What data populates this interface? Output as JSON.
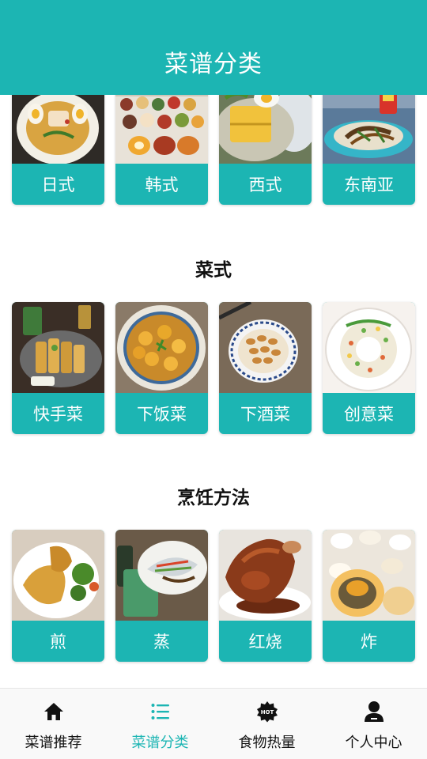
{
  "header": {
    "title": "菜谱分类"
  },
  "sections": [
    {
      "title": "",
      "items": [
        {
          "label": "日式",
          "image": "japanese-dish-photo"
        },
        {
          "label": "韩式",
          "image": "korean-dish-photo"
        },
        {
          "label": "西式",
          "image": "western-dish-photo"
        },
        {
          "label": "东南亚",
          "image": "southeast-asian-dish-photo"
        }
      ]
    },
    {
      "title": "菜式",
      "items": [
        {
          "label": "快手菜",
          "image": "quick-dish-photo"
        },
        {
          "label": "下饭菜",
          "image": "rice-dish-photo"
        },
        {
          "label": "下酒菜",
          "image": "wine-dish-photo"
        },
        {
          "label": "创意菜",
          "image": "creative-dish-photo"
        }
      ]
    },
    {
      "title": "烹饪方法",
      "items": [
        {
          "label": "煎",
          "image": "pan-fried-photo"
        },
        {
          "label": "蒸",
          "image": "steamed-photo"
        },
        {
          "label": "红烧",
          "image": "braised-photo"
        },
        {
          "label": "炸",
          "image": "deep-fried-photo"
        }
      ]
    }
  ],
  "tabbar": {
    "items": [
      {
        "label": "菜谱推荐",
        "icon": "home-icon",
        "active": false
      },
      {
        "label": "菜谱分类",
        "icon": "list-icon",
        "active": true
      },
      {
        "label": "食物热量",
        "icon": "hot-badge-icon",
        "active": false
      },
      {
        "label": "个人中心",
        "icon": "user-icon",
        "active": false
      }
    ]
  },
  "colors": {
    "accent": "#1cb5b3",
    "tab_active": "#1cb5b3",
    "tab_inactive": "#111111"
  }
}
